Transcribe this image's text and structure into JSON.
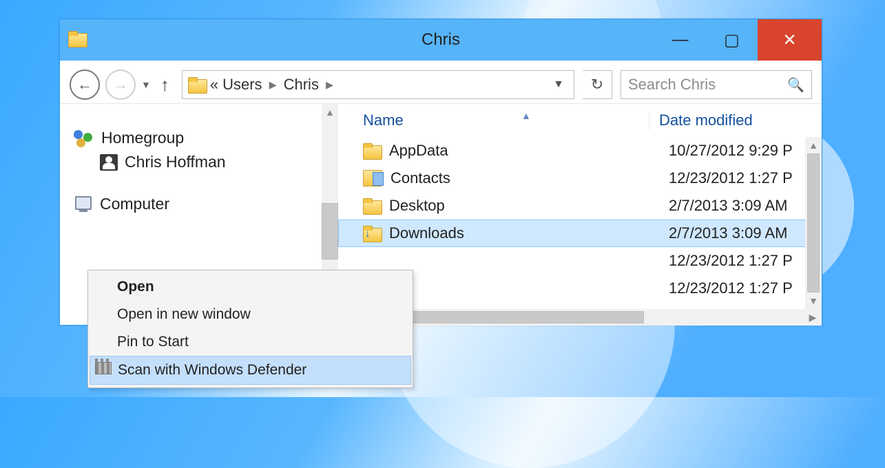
{
  "window": {
    "title": "Chris"
  },
  "nav": {
    "breadcrumb_prefix": "«",
    "crumb1": "Users",
    "crumb2": "Chris",
    "search_placeholder": "Search Chris"
  },
  "tree": {
    "homegroup": "Homegroup",
    "user": "Chris Hoffman",
    "computer": "Computer"
  },
  "columns": {
    "name": "Name",
    "date": "Date modified"
  },
  "files": [
    {
      "name": "AppData",
      "date": "10/27/2012 9:29 P"
    },
    {
      "name": "Contacts",
      "date": "12/23/2012 1:27 P"
    },
    {
      "name": "Desktop",
      "date": "2/7/2013 3:09 AM"
    },
    {
      "name": "Downloads",
      "date": "2/7/2013 3:09 AM"
    },
    {
      "name": "",
      "date": "12/23/2012 1:27 P"
    },
    {
      "name": "",
      "date": "12/23/2012 1:27 P"
    }
  ],
  "menu": {
    "open": "Open",
    "open_new": "Open in new window",
    "pin": "Pin to Start",
    "scan": "Scan with Windows Defender"
  }
}
